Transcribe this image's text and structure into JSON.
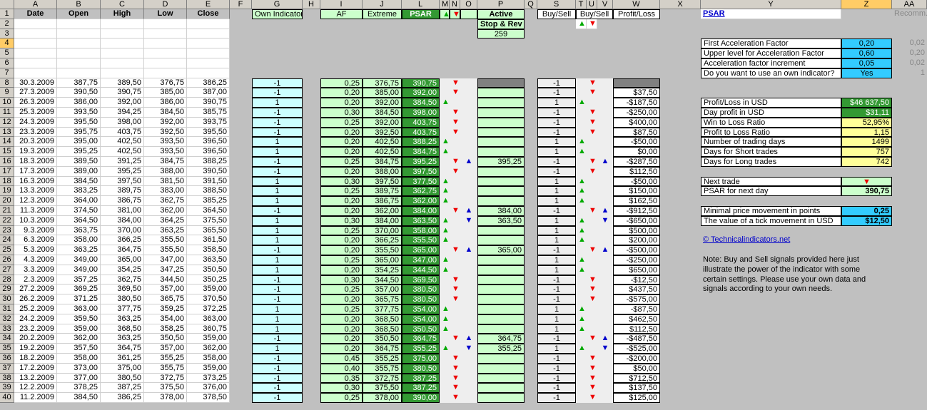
{
  "columns": [
    "A",
    "B",
    "C",
    "D",
    "E",
    "F",
    "G",
    "H",
    "I",
    "J",
    "L",
    "M",
    "N",
    "O",
    "P",
    "Q",
    "S",
    "T",
    "U",
    "V",
    "W",
    "X",
    "Y",
    "Z",
    "AA"
  ],
  "row_numbers": [
    "1",
    "2",
    "3",
    "4",
    "5",
    "6",
    "7",
    "8",
    "9",
    "10",
    "11",
    "12",
    "13",
    "14",
    "15",
    "16",
    "17",
    "18",
    "19",
    "20",
    "21",
    "22",
    "23",
    "24",
    "25",
    "26",
    "27",
    "28",
    "29",
    "30",
    "31",
    "32",
    "33",
    "34",
    "35",
    "36",
    "37",
    "38",
    "39",
    "40"
  ],
  "headers": {
    "date": "Date",
    "open": "Open",
    "high": "High",
    "low": "Low",
    "close": "Close",
    "own_indicator": "Own Indicator",
    "af": "AF",
    "extreme": "Extreme",
    "psar": "PSAR",
    "active": "Active",
    "stop_rev": "Stop & Rev",
    "stop_rev_value": "259",
    "buy_sell": "Buy/Sell",
    "buy_sell2": "Buy/Sell",
    "profit_loss": "Profit/Loss",
    "psar_link": "PSAR",
    "recomm": "Recomm.",
    "up_arrow": "▲",
    "down_arrow": "▼"
  },
  "settings": [
    {
      "label": "First Acceleration Factor",
      "value": "0,20",
      "rec": "0,02"
    },
    {
      "label": "Upper level for Acceleration Factor",
      "value": "0,60",
      "rec": "0,20"
    },
    {
      "label": "Acceleration factor increment",
      "value": "0,05",
      "rec": "0,02"
    },
    {
      "label": "Do you want to use an own indicator?",
      "value": "Yes",
      "rec": "1"
    }
  ],
  "stats": [
    {
      "label": "Profit/Loss in USD",
      "value": "$46 637,50",
      "style": "dg"
    },
    {
      "label": "Day profit in USD",
      "value": "$31,11",
      "style": "dg"
    },
    {
      "label": "Win to Loss Ratio",
      "value": "52,95%",
      "style": "ye"
    },
    {
      "label": "Profit to Loss Ratio",
      "value": "1,15",
      "style": "ye"
    },
    {
      "label": "Number of trading days",
      "value": "1499",
      "style": "ye"
    },
    {
      "label": "Days for Short trades",
      "value": "757",
      "style": "ye"
    },
    {
      "label": "Days for Long trades",
      "value": "742",
      "style": "ye"
    }
  ],
  "next_trade": {
    "label": "Next trade",
    "value": "▼",
    "psar_label": "PSAR for next day",
    "psar_value": "390,75"
  },
  "tick": {
    "label1": "Minimal price movement in points",
    "value1": "0,25",
    "label2": "The value of a tick movement in USD",
    "value2": "$12,50"
  },
  "link": "© Technicalindicators.net",
  "note": [
    "Note: Buy and Sell signals provided here just",
    "illustrate the power of the indicator with some",
    "certain settings. Please use your own data and",
    "signals according to your own needs."
  ],
  "rows": [
    {
      "date": "30.3.2009",
      "open": "387,75",
      "high": "389,50",
      "low": "376,75",
      "close": "386,25",
      "g": "-1",
      "af": "0,25",
      "ext": "376,75",
      "psar": "390,75",
      "m": "",
      "n": "▼",
      "o": "",
      "p": "",
      "s": "-1",
      "t": "",
      "u": "▼",
      "v": "",
      "w": ""
    },
    {
      "date": "27.3.2009",
      "open": "390,50",
      "high": "390,75",
      "low": "385,00",
      "close": "387,00",
      "g": "-1",
      "af": "0,20",
      "ext": "385,00",
      "psar": "392,00",
      "m": "",
      "n": "▼",
      "o": "",
      "p": "",
      "s": "-1",
      "t": "",
      "u": "▼",
      "v": "",
      "w": "$37,50"
    },
    {
      "date": "26.3.2009",
      "open": "386,00",
      "high": "392,00",
      "low": "386,00",
      "close": "390,75",
      "g": "1",
      "af": "0,20",
      "ext": "392,00",
      "psar": "384,50",
      "m": "▲",
      "n": "",
      "o": "",
      "p": "",
      "s": "1",
      "t": "▲",
      "u": "",
      "v": "",
      "w": "-$187,50"
    },
    {
      "date": "25.3.2009",
      "open": "393,50",
      "high": "394,25",
      "low": "384,50",
      "close": "385,75",
      "g": "-1",
      "af": "0,30",
      "ext": "384,50",
      "psar": "398,00",
      "m": "",
      "n": "▼",
      "o": "",
      "p": "",
      "s": "-1",
      "t": "",
      "u": "▼",
      "v": "",
      "w": "-$250,00"
    },
    {
      "date": "24.3.2009",
      "open": "395,50",
      "high": "398,00",
      "low": "392,00",
      "close": "393,75",
      "g": "-1",
      "af": "0,25",
      "ext": "392,00",
      "psar": "403,75",
      "m": "",
      "n": "▼",
      "o": "",
      "p": "",
      "s": "-1",
      "t": "",
      "u": "▼",
      "v": "",
      "w": "$400,00"
    },
    {
      "date": "23.3.2009",
      "open": "395,75",
      "high": "403,75",
      "low": "392,50",
      "close": "395,50",
      "g": "-1",
      "af": "0,20",
      "ext": "392,50",
      "psar": "403,75",
      "m": "",
      "n": "▼",
      "o": "",
      "p": "",
      "s": "-1",
      "t": "",
      "u": "▼",
      "v": "",
      "w": "$87,50"
    },
    {
      "date": "20.3.2009",
      "open": "395,00",
      "high": "402,50",
      "low": "393,50",
      "close": "396,50",
      "g": "1",
      "af": "0,20",
      "ext": "402,50",
      "psar": "388,25",
      "m": "▲",
      "n": "",
      "o": "",
      "p": "",
      "s": "1",
      "t": "▲",
      "u": "",
      "v": "",
      "w": "-$50,00"
    },
    {
      "date": "19.3.2009",
      "open": "395,25",
      "high": "402,50",
      "low": "393,50",
      "close": "396,50",
      "g": "1",
      "af": "0,20",
      "ext": "402,50",
      "psar": "384,75",
      "m": "▲",
      "n": "",
      "o": "",
      "p": "",
      "s": "1",
      "t": "▲",
      "u": "",
      "v": "",
      "w": "$0,00"
    },
    {
      "date": "18.3.2009",
      "open": "389,50",
      "high": "391,25",
      "low": "384,75",
      "close": "388,25",
      "g": "-1",
      "af": "0,25",
      "ext": "384,75",
      "psar": "395,25",
      "m": "",
      "n": "▼",
      "o": "▲",
      "p": "395,25",
      "s": "-1",
      "t": "",
      "u": "▼",
      "v": "▲",
      "w": "-$287,50"
    },
    {
      "date": "17.3.2009",
      "open": "389,00",
      "high": "395,25",
      "low": "388,00",
      "close": "390,50",
      "g": "-1",
      "af": "0,20",
      "ext": "388,00",
      "psar": "397,50",
      "m": "",
      "n": "▼",
      "o": "",
      "p": "",
      "s": "-1",
      "t": "",
      "u": "▼",
      "v": "",
      "w": "$112,50"
    },
    {
      "date": "16.3.2009",
      "open": "384,50",
      "high": "397,50",
      "low": "381,50",
      "close": "391,50",
      "g": "1",
      "af": "0,30",
      "ext": "397,50",
      "psar": "377,50",
      "m": "▲",
      "n": "",
      "o": "",
      "p": "",
      "s": "1",
      "t": "▲",
      "u": "",
      "v": "",
      "w": "-$50,00"
    },
    {
      "date": "13.3.2009",
      "open": "383,25",
      "high": "389,75",
      "low": "383,00",
      "close": "388,50",
      "g": "1",
      "af": "0,25",
      "ext": "389,75",
      "psar": "362,75",
      "m": "▲",
      "n": "",
      "o": "",
      "p": "",
      "s": "1",
      "t": "▲",
      "u": "",
      "v": "",
      "w": "$150,00"
    },
    {
      "date": "12.3.2009",
      "open": "364,00",
      "high": "386,75",
      "low": "362,75",
      "close": "385,25",
      "g": "1",
      "af": "0,20",
      "ext": "386,75",
      "psar": "362,00",
      "m": "▲",
      "n": "",
      "o": "",
      "p": "",
      "s": "1",
      "t": "▲",
      "u": "",
      "v": "",
      "w": "$162,50"
    },
    {
      "date": "11.3.2009",
      "open": "374,50",
      "high": "381,00",
      "low": "362,00",
      "close": "364,50",
      "g": "-1",
      "af": "0,20",
      "ext": "362,00",
      "psar": "384,00",
      "m": "",
      "n": "▼",
      "o": "▲",
      "p": "384,00",
      "s": "-1",
      "t": "",
      "u": "▼",
      "v": "▲",
      "w": "-$912,50"
    },
    {
      "date": "10.3.2009",
      "open": "364,50",
      "high": "384,00",
      "low": "364,25",
      "close": "375,50",
      "g": "1",
      "af": "0,30",
      "ext": "384,00",
      "psar": "363,50",
      "m": "▲",
      "n": "",
      "o": "▼",
      "p": "363,50",
      "s": "1",
      "t": "▲",
      "u": "",
      "v": "▼",
      "w": "-$650,00"
    },
    {
      "date": "9.3.2009",
      "open": "363,75",
      "high": "370,00",
      "low": "363,25",
      "close": "365,50",
      "g": "1",
      "af": "0,25",
      "ext": "370,00",
      "psar": "358,00",
      "m": "▲",
      "n": "",
      "o": "",
      "p": "",
      "s": "1",
      "t": "▲",
      "u": "",
      "v": "",
      "w": "$500,00"
    },
    {
      "date": "6.3.2009",
      "open": "358,00",
      "high": "366,25",
      "low": "355,50",
      "close": "361,50",
      "g": "1",
      "af": "0,20",
      "ext": "366,25",
      "psar": "355,50",
      "m": "▲",
      "n": "",
      "o": "",
      "p": "",
      "s": "1",
      "t": "▲",
      "u": "",
      "v": "",
      "w": "$200,00"
    },
    {
      "date": "5.3.2009",
      "open": "363,25",
      "high": "364,75",
      "low": "355,50",
      "close": "358,50",
      "g": "-1",
      "af": "0,20",
      "ext": "355,50",
      "psar": "365,00",
      "m": "",
      "n": "▼",
      "o": "▲",
      "p": "365,00",
      "s": "-1",
      "t": "",
      "u": "▼",
      "v": "▲",
      "w": "-$500,00"
    },
    {
      "date": "4.3.2009",
      "open": "349,00",
      "high": "365,00",
      "low": "347,00",
      "close": "363,50",
      "g": "1",
      "af": "0,25",
      "ext": "365,00",
      "psar": "347,00",
      "m": "▲",
      "n": "",
      "o": "",
      "p": "",
      "s": "1",
      "t": "▲",
      "u": "",
      "v": "",
      "w": "-$250,00"
    },
    {
      "date": "3.3.2009",
      "open": "349,00",
      "high": "354,25",
      "low": "347,25",
      "close": "350,50",
      "g": "1",
      "af": "0,20",
      "ext": "354,25",
      "psar": "344,50",
      "m": "▲",
      "n": "",
      "o": "",
      "p": "",
      "s": "1",
      "t": "▲",
      "u": "",
      "v": "",
      "w": "$650,00"
    },
    {
      "date": "2.3.2009",
      "open": "357,25",
      "high": "362,75",
      "low": "344,50",
      "close": "350,25",
      "g": "-1",
      "af": "0,30",
      "ext": "344,50",
      "psar": "369,50",
      "m": "",
      "n": "▼",
      "o": "",
      "p": "",
      "s": "-1",
      "t": "",
      "u": "▼",
      "v": "",
      "w": "-$12,50"
    },
    {
      "date": "27.2.2009",
      "open": "369,25",
      "high": "369,50",
      "low": "357,00",
      "close": "359,00",
      "g": "-1",
      "af": "0,25",
      "ext": "357,00",
      "psar": "380,50",
      "m": "",
      "n": "▼",
      "o": "",
      "p": "",
      "s": "-1",
      "t": "",
      "u": "▼",
      "v": "",
      "w": "$437,50"
    },
    {
      "date": "26.2.2009",
      "open": "371,25",
      "high": "380,50",
      "low": "365,75",
      "close": "370,50",
      "g": "-1",
      "af": "0,20",
      "ext": "365,75",
      "psar": "380,50",
      "m": "",
      "n": "▼",
      "o": "",
      "p": "",
      "s": "-1",
      "t": "",
      "u": "▼",
      "v": "",
      "w": "-$575,00"
    },
    {
      "date": "25.2.2009",
      "open": "363,00",
      "high": "377,75",
      "low": "359,25",
      "close": "372,25",
      "g": "1",
      "af": "0,25",
      "ext": "377,75",
      "psar": "354,00",
      "m": "▲",
      "n": "",
      "o": "",
      "p": "",
      "s": "1",
      "t": "▲",
      "u": "",
      "v": "",
      "w": "-$87,50"
    },
    {
      "date": "24.2.2009",
      "open": "359,50",
      "high": "363,25",
      "low": "354,00",
      "close": "363,00",
      "g": "1",
      "af": "0,20",
      "ext": "368,50",
      "psar": "354,00",
      "m": "▲",
      "n": "",
      "o": "",
      "p": "",
      "s": "1",
      "t": "▲",
      "u": "",
      "v": "",
      "w": "$462,50"
    },
    {
      "date": "23.2.2009",
      "open": "359,00",
      "high": "368,50",
      "low": "358,25",
      "close": "360,75",
      "g": "1",
      "af": "0,20",
      "ext": "368,50",
      "psar": "350,50",
      "m": "▲",
      "n": "",
      "o": "",
      "p": "",
      "s": "1",
      "t": "▲",
      "u": "",
      "v": "",
      "w": "$112,50"
    },
    {
      "date": "20.2.2009",
      "open": "362,00",
      "high": "363,25",
      "low": "350,50",
      "close": "359,00",
      "g": "-1",
      "af": "0,20",
      "ext": "350,50",
      "psar": "364,75",
      "m": "",
      "n": "▼",
      "o": "▲",
      "p": "364,75",
      "s": "-1",
      "t": "",
      "u": "▼",
      "v": "▲",
      "w": "-$487,50"
    },
    {
      "date": "19.2.2009",
      "open": "357,50",
      "high": "364,75",
      "low": "357,00",
      "close": "362,00",
      "g": "1",
      "af": "0,20",
      "ext": "364,75",
      "psar": "355,25",
      "m": "▲",
      "n": "",
      "o": "▼",
      "p": "355,25",
      "s": "1",
      "t": "▲",
      "u": "",
      "v": "▼",
      "w": "-$525,00"
    },
    {
      "date": "18.2.2009",
      "open": "358,00",
      "high": "361,25",
      "low": "355,25",
      "close": "358,00",
      "g": "-1",
      "af": "0,45",
      "ext": "355,25",
      "psar": "375,00",
      "m": "",
      "n": "▼",
      "o": "",
      "p": "",
      "s": "-1",
      "t": "",
      "u": "▼",
      "v": "",
      "w": "-$200,00"
    },
    {
      "date": "17.2.2009",
      "open": "373,00",
      "high": "375,00",
      "low": "355,75",
      "close": "359,00",
      "g": "-1",
      "af": "0,40",
      "ext": "355,75",
      "psar": "380,50",
      "m": "",
      "n": "▼",
      "o": "",
      "p": "",
      "s": "-1",
      "t": "",
      "u": "▼",
      "v": "",
      "w": "$50,00"
    },
    {
      "date": "13.2.2009",
      "open": "377,00",
      "high": "380,50",
      "low": "372,75",
      "close": "373,25",
      "g": "-1",
      "af": "0,35",
      "ext": "372,75",
      "psar": "387,25",
      "m": "",
      "n": "▼",
      "o": "",
      "p": "",
      "s": "-1",
      "t": "",
      "u": "▼",
      "v": "",
      "w": "$712,50"
    },
    {
      "date": "12.2.2009",
      "open": "378,25",
      "high": "387,25",
      "low": "375,50",
      "close": "376,00",
      "g": "-1",
      "af": "0,30",
      "ext": "375,50",
      "psar": "387,25",
      "m": "",
      "n": "▼",
      "o": "",
      "p": "",
      "s": "-1",
      "t": "",
      "u": "▼",
      "v": "",
      "w": "$137,50"
    },
    {
      "date": "11.2.2009",
      "open": "384,50",
      "high": "386,25",
      "low": "378,00",
      "close": "378,50",
      "g": "-1",
      "af": "0,25",
      "ext": "378,00",
      "psar": "390,00",
      "m": "",
      "n": "▼",
      "o": "",
      "p": "",
      "s": "-1",
      "t": "",
      "u": "▼",
      "v": "",
      "w": "$125,00"
    }
  ]
}
